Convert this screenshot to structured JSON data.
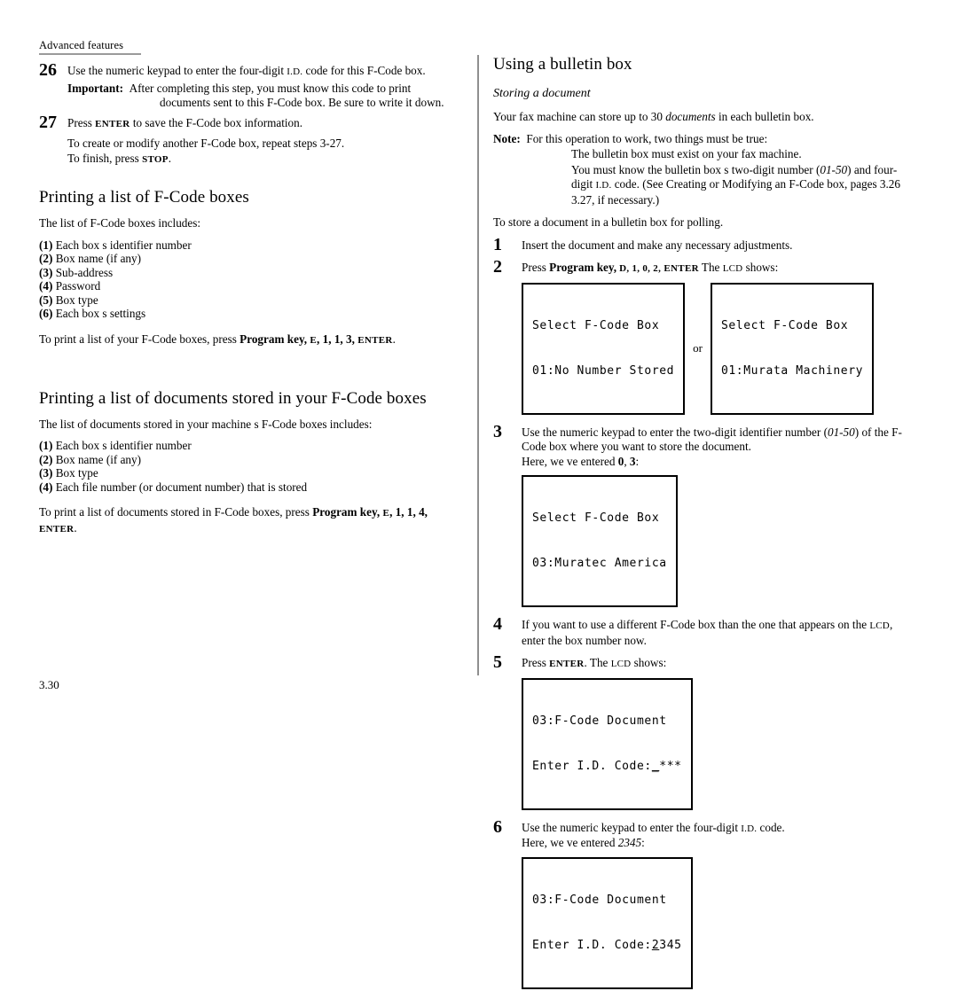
{
  "page": {
    "running_header": "Advanced features",
    "folio": "3.30"
  },
  "left_column": {
    "step26": {
      "number": "26",
      "text_pre": "Use the numeric keypad to enter the four-digit ",
      "smallcaps": "I.D.",
      "text_post": " code for this F-Code box.",
      "important_label": "Important:",
      "important_text": "After completing this step, you must know this code to print documents sent to this F-Code box. Be sure to write it down."
    },
    "step27": {
      "number": "27",
      "text_pre": "Press ",
      "key": "ENTER",
      "text_post": " to save the F-Code box information.",
      "follow_line1": "To create or modify another F-Code box, repeat steps 3-27.",
      "follow_line2_pre": "To finish, press ",
      "follow_line2_key": "STOP",
      "follow_line2_post": "."
    },
    "section1": {
      "heading": "Printing a list of F-Code boxes",
      "intro": "The list of F-Code boxes includes:",
      "items": [
        {
          "num": "(1)",
          "label": "Each box s identifier number"
        },
        {
          "num": "(2)",
          "label": "Box name (if any)"
        },
        {
          "num": "(3)",
          "label": "Sub-address"
        },
        {
          "num": "(4)",
          "label": "Password"
        },
        {
          "num": "(5)",
          "label": "Box type"
        },
        {
          "num": "(6)",
          "label": "Each box s settings"
        }
      ],
      "instruction_pre": "To print a list of your F-Code boxes, press ",
      "instruction_bold": "Program key,",
      "instruction_key_e": "E",
      "instruction_bold2": ", 1, 1, 3,",
      "instruction_enter": "ENTER",
      "instruction_post": "."
    },
    "section2": {
      "heading": "Printing a list of documents stored in your F-Code boxes",
      "intro": "The list of documents stored in your machine s F-Code boxes includes:",
      "items": [
        {
          "num": "(1)",
          "label": "Each box s identifier number"
        },
        {
          "num": "(2)",
          "label": "Box name (if any)"
        },
        {
          "num": "(3)",
          "label": "Box type"
        },
        {
          "num": "(4)",
          "label": "Each file number (or document number) that is stored"
        }
      ],
      "instruction_pre": "To print a list of documents stored in F-Code boxes, press ",
      "instruction_bold": "Program key,",
      "instruction_key_e": "E",
      "instruction_bold2": ", 1, 1, 4,",
      "instruction_enter": "ENTER",
      "instruction_post": "."
    }
  },
  "right_column": {
    "heading": "Using a bulletin box",
    "subheading": "Storing a document",
    "intro_pre": "Your fax machine can store up to 30 ",
    "intro_ital": "documents",
    "intro_post": " in each bulletin box.",
    "note": {
      "label": "Note:",
      "text": "For this operation to work, two things must be true:",
      "bullet1": "The bulletin box must exist on your fax machine.",
      "bullet2_pre": "You must know the bulletin box s two-digit number (",
      "bullet2_ital": "01-50",
      "bullet2_mid": ") and four-digit ",
      "bullet2_sc": "I.D.",
      "bullet2_post": " code. (See  Creating or Modifying an F-Code box,  pages 3.26 3.27, if necessary.)"
    },
    "lead_in": "To store a document in a bulletin box for polling.",
    "steps": [
      {
        "number": "1",
        "text": "Insert the document and make any necessary adjustments."
      },
      {
        "number": "2",
        "text_pre": "Press ",
        "bold": "Program key,",
        "bold_keys": " D, 1, 0, 2,",
        "enter": "ENTER",
        "text_mid": " The ",
        "lcd_sc": "LCD",
        "text_post": " shows:"
      },
      {
        "number": "3",
        "text_pre": "Use the numeric keypad to enter the two-digit identifier number (",
        "text_ital": "01-50",
        "text_post": ") of the F-Code box where you want to store the document.",
        "text_line2_pre": "Here, we ve entered ",
        "text_line2_bold": "0",
        "text_line2_mid": ", ",
        "text_line2_bold2": "3",
        "text_line2_post": ":"
      },
      {
        "number": "4",
        "text_pre": "If you want to use a different F-Code box than the one that appears on the ",
        "lcd_sc": "LCD",
        "text_post": ", enter the box number now."
      },
      {
        "number": "5",
        "text_pre": "Press ",
        "enter": "ENTER",
        "text_mid": ". The ",
        "lcd_sc": "LCD",
        "text_post": " shows:"
      },
      {
        "number": "6",
        "text_pre": "Use the numeric keypad to enter the four-digit ",
        "sc": "I.D.",
        "text_post": " code.",
        "text_line2_pre": "Here, we ve entered ",
        "text_line2_ital": "2345",
        "text_line2_post": ":"
      }
    ],
    "lcd_screens": {
      "step2_a_line1": "Select F-Code Box",
      "step2_a_line2": "01:No Number Stored",
      "or_label": "or",
      "step2_b_line1": "Select F-Code Box",
      "step2_b_line2": "01:Murata Machinery",
      "step3_line1": "Select F-Code Box",
      "step3_line2": "03:Muratec America",
      "step5_line1": "03:F-Code Document",
      "step5_line2_pre": "Enter I.D. Code:",
      "step5_line2_cursor": "_",
      "step5_line2_stars": "***",
      "step6_line1": "03:F-Code Document",
      "step6_line2_pre": "Enter I.D. Code:",
      "step6_line2_cursor": "2",
      "step6_line2_rest": "345"
    }
  }
}
